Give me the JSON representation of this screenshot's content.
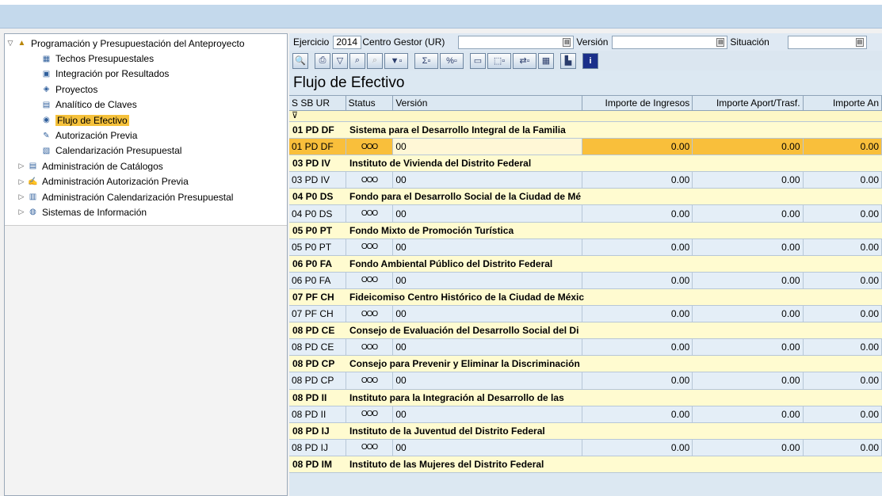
{
  "nav": {
    "root_label": "Programación y Presupuestación del Anteproyecto",
    "items": [
      {
        "label": "Techos Presupuestales",
        "icon": "budget-ceiling-icon"
      },
      {
        "label": "Integración por Resultados",
        "icon": "integration-icon"
      },
      {
        "label": "Proyectos",
        "icon": "projects-icon"
      },
      {
        "label": "Analítico de Claves",
        "icon": "analytic-keys-icon"
      },
      {
        "label": "Flujo de Efectivo",
        "icon": "cash-flow-icon"
      },
      {
        "label": "Autorización Previa",
        "icon": "authorization-icon"
      },
      {
        "label": "Calendarización Presupuestal",
        "icon": "calendar-icon"
      }
    ],
    "folders": [
      {
        "label": "Administración de Catálogos",
        "icon": "catalog-icon"
      },
      {
        "label": "Administración Autorización Previa",
        "icon": "admin-auth-icon"
      },
      {
        "label": "Administración Calendarización Presupuestal",
        "icon": "admin-calendar-icon"
      },
      {
        "label": "Sistemas de Información",
        "icon": "info-systems-icon"
      }
    ]
  },
  "selection": {
    "ejercicio_label": "Ejercicio",
    "ejercicio_value": "2014",
    "centro_label": "Centro Gestor (UR)",
    "centro_value": "",
    "version_label": "Versión",
    "version_value": "",
    "situacion_label": "Situación",
    "situacion_value": ""
  },
  "page_title": "Flujo de Efectivo",
  "grid": {
    "headers": [
      "S SB UR",
      "Status",
      "Versión",
      "Importe de Ingresos",
      "Importe Aport/Trasf.",
      "Importe An"
    ],
    "filter_icon": "filter-icon",
    "groups": [
      {
        "code": "01 PD DF",
        "name": "Sistema para el Desarrollo Integral de la Familia",
        "row": {
          "ur": "01 PD DF",
          "status": "OOO",
          "version": "00",
          "ingresos": "0.00",
          "aport": "0.00",
          "an": "0.00"
        }
      },
      {
        "code": "03 PD IV",
        "name": "Instituto de Vivienda del Distrito Federal",
        "row": {
          "ur": "03 PD IV",
          "status": "OOO",
          "version": "00",
          "ingresos": "0.00",
          "aport": "0.00",
          "an": "0.00"
        }
      },
      {
        "code": "04 P0 DS",
        "name": "Fondo para el Desarrollo Social de la Ciudad de Mé",
        "row": {
          "ur": "04 P0 DS",
          "status": "OOO",
          "version": "00",
          "ingresos": "0.00",
          "aport": "0.00",
          "an": "0.00"
        }
      },
      {
        "code": "05 P0 PT",
        "name": "Fondo Mixto de Promoción Turística",
        "row": {
          "ur": "05 P0 PT",
          "status": "OOO",
          "version": "00",
          "ingresos": "0.00",
          "aport": "0.00",
          "an": "0.00"
        }
      },
      {
        "code": "06 P0 FA",
        "name": "Fondo Ambiental Público del Distrito Federal",
        "row": {
          "ur": "06 P0 FA",
          "status": "OOO",
          "version": "00",
          "ingresos": "0.00",
          "aport": "0.00",
          "an": "0.00"
        }
      },
      {
        "code": "07 PF CH",
        "name": "Fideicomiso Centro Histórico de la Ciudad de Méxic",
        "row": {
          "ur": "07 PF CH",
          "status": "OOO",
          "version": "00",
          "ingresos": "0.00",
          "aport": "0.00",
          "an": "0.00"
        }
      },
      {
        "code": "08 PD CE",
        "name": "Consejo de Evaluación del Desarrollo Social del Di",
        "row": {
          "ur": "08 PD CE",
          "status": "OOO",
          "version": "00",
          "ingresos": "0.00",
          "aport": "0.00",
          "an": "0.00"
        }
      },
      {
        "code": "08 PD CP",
        "name": "Consejo para Prevenir y Eliminar la Discriminación",
        "row": {
          "ur": "08 PD CP",
          "status": "OOO",
          "version": "00",
          "ingresos": "0.00",
          "aport": "0.00",
          "an": "0.00"
        }
      },
      {
        "code": "08 PD II",
        "name": "Instituto para la Integración al Desarrollo de las",
        "row": {
          "ur": "08 PD II",
          "status": "OOO",
          "version": "00",
          "ingresos": "0.00",
          "aport": "0.00",
          "an": "0.00"
        }
      },
      {
        "code": "08 PD IJ",
        "name": "Instituto de la Juventud del Distrito Federal",
        "row": {
          "ur": "08 PD IJ",
          "status": "OOO",
          "version": "00",
          "ingresos": "0.00",
          "aport": "0.00",
          "an": "0.00"
        }
      },
      {
        "code": "08 PD IM",
        "name": "Instituto de las Mujeres del Distrito Federal",
        "row": null
      }
    ]
  }
}
